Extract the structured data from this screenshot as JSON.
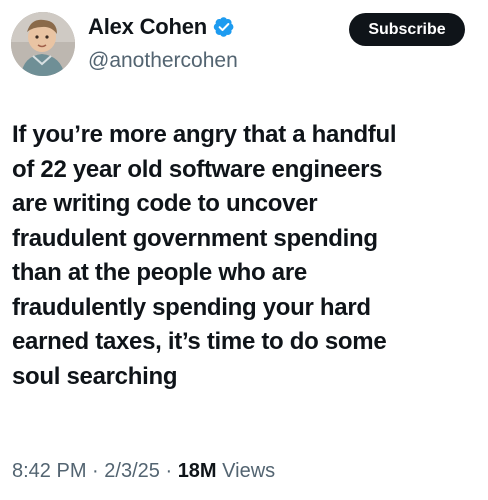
{
  "author": {
    "display_name": "Alex Cohen",
    "handle": "@anothercohen",
    "verified": true,
    "verified_icon": "verified-badge-icon",
    "verified_color": "#1d9bf0",
    "avatar": "child-photo-avatar"
  },
  "actions": {
    "subscribe_label": "Subscribe"
  },
  "tweet": {
    "text": "If you’re more angry that a handful\nof 22 year old software engineers\nare writing code to uncover\nfraudulent government spending\nthan at the people who are\nfraudulently spending your hard\nearned taxes, it’s time to do some\nsoul searching"
  },
  "meta": {
    "time": "8:42 PM",
    "separator": "·",
    "date": "2/3/25",
    "views_count": "18M",
    "views_label": "Views"
  },
  "colors": {
    "text_primary": "#0f1419",
    "text_secondary": "#536471",
    "button_bg": "#0f1419",
    "button_text": "#ffffff",
    "background": "#ffffff"
  }
}
